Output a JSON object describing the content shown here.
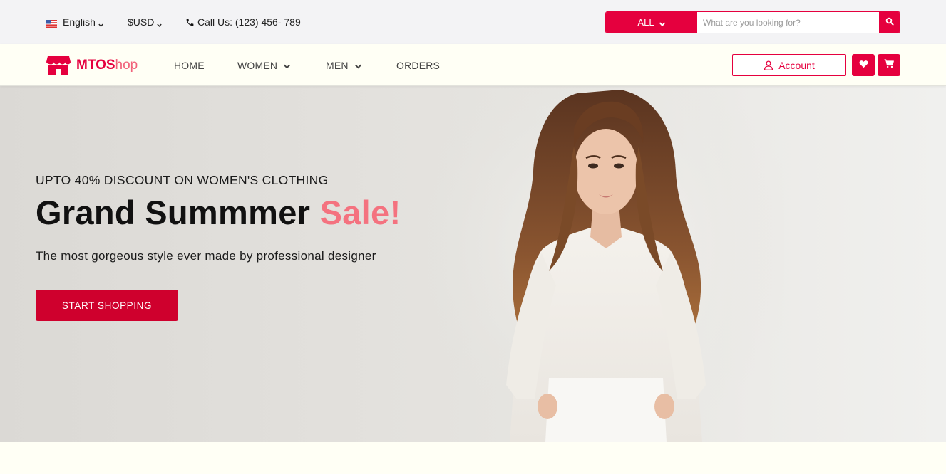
{
  "colors": {
    "accent": "#e5003e",
    "accent_light": "#f4727f",
    "cta": "#cf002d",
    "topbar_bg": "#f3f3f5",
    "nav_bg": "#fffff5"
  },
  "topbar": {
    "language": {
      "label": "English",
      "flag_icon": "us-flag-icon"
    },
    "currency": {
      "label": "$USD"
    },
    "call": {
      "label": "Call Us: (123) 456- 789",
      "icon": "phone-icon"
    }
  },
  "search": {
    "category": "ALL",
    "placeholder": "What are you looking for?",
    "value": "",
    "icon": "search-icon"
  },
  "logo": {
    "part1": "MTOS",
    "part2": "hop",
    "icon": "store-icon"
  },
  "nav": {
    "items": [
      {
        "label": "HOME",
        "dropdown": false
      },
      {
        "label": "WOMEN",
        "dropdown": true
      },
      {
        "label": "MEN",
        "dropdown": true
      },
      {
        "label": "ORDERS",
        "dropdown": false
      }
    ]
  },
  "actions": {
    "account_label": "Account",
    "account_icon": "user-icon",
    "wishlist_icon": "heart-icon",
    "cart_icon": "cart-icon"
  },
  "hero": {
    "eyebrow": "UPTO 40% DISCOUNT ON WOMEN'S CLOTHING",
    "title_main": "Grand Summmer ",
    "title_accent": "Sale!",
    "subtitle": "The most gorgeous style ever made by professional designer",
    "cta_label": "START SHOPPING",
    "image": "model-in-white-blouse"
  }
}
